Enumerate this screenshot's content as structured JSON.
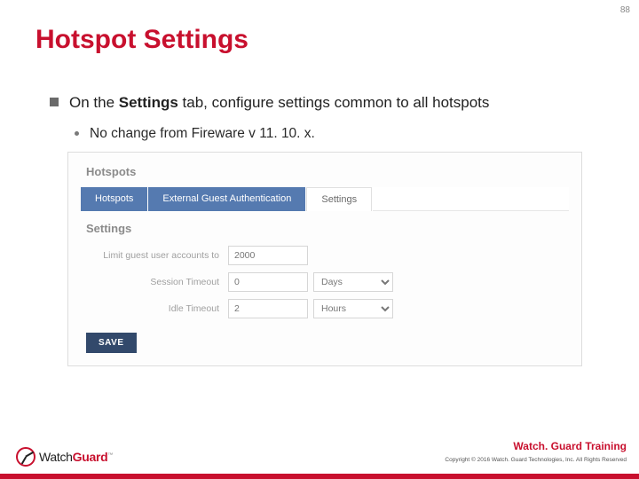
{
  "page_number": "88",
  "title": "Hotspot Settings",
  "bullets": {
    "main_prefix": "On the ",
    "main_strong": "Settings",
    "main_suffix": " tab, configure settings common to all hotspots",
    "sub": "No change from Fireware v 11. 10. x."
  },
  "screenshot": {
    "breadcrumb": "Hotspots",
    "tabs": [
      "Hotspots",
      "External Guest Authentication",
      "Settings"
    ],
    "active_tab_index": 2,
    "section": "Settings",
    "rows": {
      "limit_label": "Limit guest user accounts to",
      "limit_value": "2000",
      "session_label": "Session Timeout",
      "session_value": "0",
      "session_unit": "Days",
      "idle_label": "Idle Timeout",
      "idle_value": "2",
      "idle_unit": "Hours"
    },
    "save": "SAVE"
  },
  "footer": {
    "training": "Watch. Guard Training",
    "copyright": "Copyright © 2016 Watch. Guard Technologies, Inc. All Rights Reserved",
    "logo_part1": "Watch",
    "logo_part2": "Guard",
    "tm": "™"
  }
}
